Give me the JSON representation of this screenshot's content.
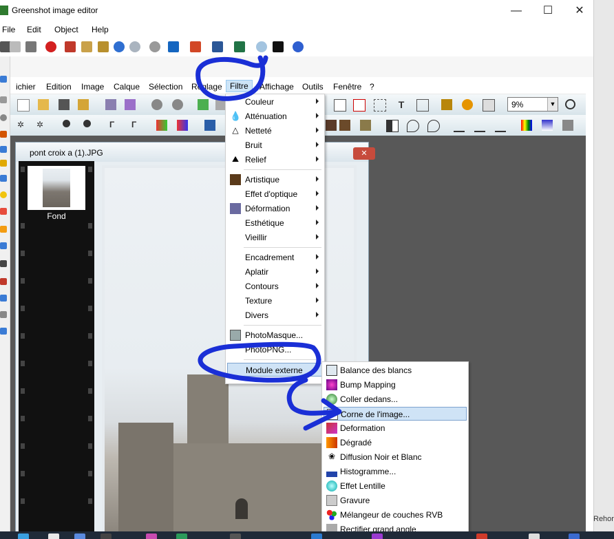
{
  "greenshot": {
    "title": "Greenshot image editor",
    "menu": [
      "File",
      "Edit",
      "Object",
      "Help"
    ],
    "window_buttons": {
      "minimize": "—",
      "maximize": "☐",
      "close": "✕"
    }
  },
  "photofiltre": {
    "menu": [
      "ichier",
      "Edition",
      "Image",
      "Calque",
      "Sélection",
      "Réglage",
      "Filtre",
      "Affichage",
      "Outils",
      "Fenêtre",
      "?"
    ],
    "active_menu": "Filtre",
    "zoom": "9%",
    "document": {
      "title": "pont croix a (1).JPG",
      "close_label": "✕",
      "layer_label": "Fond"
    }
  },
  "filtre_menu": {
    "items": [
      {
        "label": "Couleur",
        "submenu": true
      },
      {
        "label": "Atténuation",
        "submenu": true
      },
      {
        "label": "Netteté",
        "submenu": true
      },
      {
        "label": "Bruit",
        "submenu": true
      },
      {
        "label": "Relief",
        "submenu": true
      },
      {
        "label": "Artistique",
        "submenu": true
      },
      {
        "label": "Effet d'optique",
        "submenu": true
      },
      {
        "label": "Déformation",
        "submenu": true
      },
      {
        "label": "Esthétique",
        "submenu": true
      },
      {
        "label": "Vieillir",
        "submenu": true
      },
      {
        "label": "Encadrement",
        "submenu": true
      },
      {
        "label": "Aplatir",
        "submenu": true
      },
      {
        "label": "Contours",
        "submenu": true
      },
      {
        "label": "Texture",
        "submenu": true
      },
      {
        "label": "Divers",
        "submenu": true
      },
      {
        "label": "PhotoMasque...",
        "submenu": false
      },
      {
        "label": "PhotoPNG...",
        "submenu": false
      },
      {
        "label": "Module externe",
        "submenu": true,
        "highlighted": true
      }
    ]
  },
  "module_externe_menu": {
    "items": [
      {
        "label": "Balance des blancs"
      },
      {
        "label": "Bump Mapping"
      },
      {
        "label": "Coller dedans..."
      },
      {
        "label": "Corne de l'image...",
        "highlighted": true
      },
      {
        "label": "Deformation"
      },
      {
        "label": "Dégradé"
      },
      {
        "label": "Diffusion Noir et Blanc"
      },
      {
        "label": "Histogramme..."
      },
      {
        "label": "Effet Lentille"
      },
      {
        "label": "Gravure"
      },
      {
        "label": "Mélangeur de couches RVB"
      },
      {
        "label": "Rectifier grand angle"
      }
    ]
  },
  "side_text": "Rehors",
  "colors": {
    "annotation_pen": "#1a2fd6",
    "menu_highlight": "#cfe3f6",
    "workspace": "#585858",
    "filmstrip": "#111111",
    "taskbar": "#1f2a38"
  }
}
